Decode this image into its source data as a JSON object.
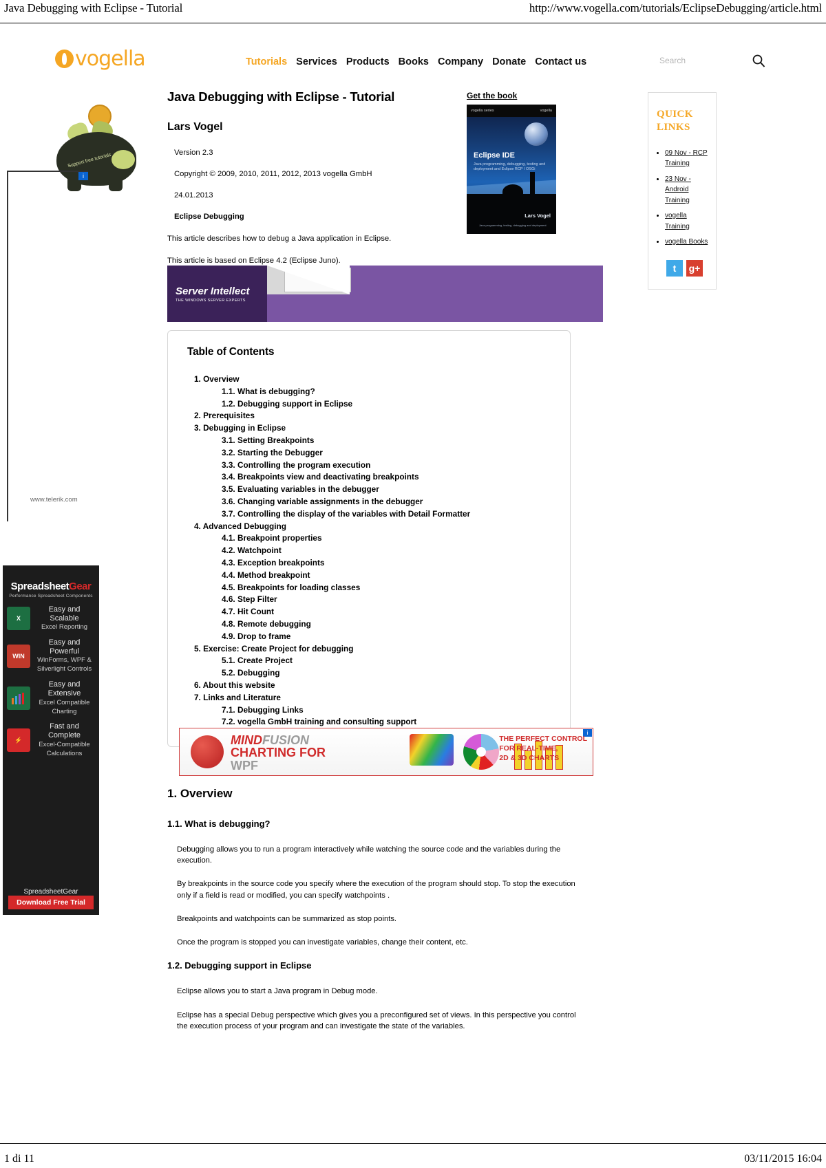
{
  "print": {
    "header_title": "Java Debugging with Eclipse - Tutorial",
    "header_url": "http://www.vogella.com/tutorials/EclipseDebugging/article.html",
    "footer_page": "1 di 11",
    "footer_timestamp": "03/11/2015 16:04"
  },
  "brand": {
    "logo_text": "vogella"
  },
  "nav": {
    "items": [
      {
        "label": "Tutorials",
        "active": true
      },
      {
        "label": "Services",
        "active": false
      },
      {
        "label": "Products",
        "active": false
      },
      {
        "label": "Books",
        "active": false
      },
      {
        "label": "Company",
        "active": false
      },
      {
        "label": "Donate",
        "active": false
      },
      {
        "label": "Contact us",
        "active": false
      }
    ],
    "search_placeholder": "Search"
  },
  "article": {
    "title": "Java Debugging with Eclipse - Tutorial",
    "author": "Lars Vogel",
    "version": "Version 2.3",
    "copyright": "Copyright © 2009, 2010, 2011, 2012, 2013 vogella GmbH",
    "date": "24.01.2013",
    "subject": "Eclipse Debugging",
    "intro1": "This article describes how to debug a Java application in Eclipse.",
    "intro2": "This article is based on Eclipse 4.2 (Eclipse Juno)."
  },
  "book_promo": {
    "label": "Get the book",
    "cover_brand_left": "vogella series",
    "cover_brand_right": "vogella",
    "cover_title": "Eclipse IDE",
    "cover_subtitle": "Java programming, debugging, testing and deployment and Eclipse RCP / OSGi",
    "cover_author": "Lars Vogel",
    "cover_footnote": "Java programming, testing, debugging and deployment"
  },
  "ads": {
    "server_intellect": {
      "name": "Server Intellect",
      "tagline": "THE WINDOWS SERVER EXPERTS"
    },
    "telerik": {
      "site": "www.telerik.com",
      "adchoice": "i"
    },
    "spreadsheetgear": {
      "logo_main": "Spreadsheet",
      "logo_accent": "Gear",
      "tagline": "Performance Spreadsheet Components",
      "features": [
        {
          "icon": "excel-icon",
          "icon_label": "X",
          "line1": "Easy and Scalable",
          "line2": "Excel Reporting"
        },
        {
          "icon": "winforms-icon",
          "icon_label": "WIN",
          "line1": "Easy and Powerful",
          "line2": "WinForms, WPF & Silverlight Controls"
        },
        {
          "icon": "chart-icon",
          "icon_label": "",
          "line1": "Easy and Extensive",
          "line2": "Excel Compatible Charting"
        },
        {
          "icon": "calc-icon",
          "icon_label": "",
          "line1": "Fast and Complete",
          "line2": "Excel-Compatible Calculations"
        }
      ],
      "footer_brand": "SpreadsheetGear",
      "cta": "Download Free Trial"
    },
    "mindfusion": {
      "line1_a": "MIND",
      "line1_b": "FUSION",
      "line2": "CHARTING FOR",
      "line3": "WPF",
      "right1": "THE PERFECT CONTROL",
      "right2": "FOR REAL-TIME,",
      "right3": "2D & 3D CHARTS",
      "adchoice": "i"
    }
  },
  "toc": {
    "heading": "Table of Contents",
    "items": [
      {
        "num": "1.",
        "label": "Overview",
        "level": 1
      },
      {
        "num": "1.1.",
        "label": "What is debugging?",
        "level": 2
      },
      {
        "num": "1.2.",
        "label": "Debugging support in Eclipse",
        "level": 2
      },
      {
        "num": "2.",
        "label": "Prerequisites",
        "level": 1
      },
      {
        "num": "3.",
        "label": "Debugging in Eclipse",
        "level": 1
      },
      {
        "num": "3.1.",
        "label": "Setting Breakpoints",
        "level": 2
      },
      {
        "num": "3.2.",
        "label": "Starting the Debugger",
        "level": 2
      },
      {
        "num": "3.3.",
        "label": "Controlling the program execution",
        "level": 2
      },
      {
        "num": "3.4.",
        "label": "Breakpoints view and deactivating breakpoints",
        "level": 2
      },
      {
        "num": "3.5.",
        "label": "Evaluating variables in the debugger",
        "level": 2
      },
      {
        "num": "3.6.",
        "label": "Changing variable assignments in the debugger",
        "level": 2
      },
      {
        "num": "3.7.",
        "label": "Controlling the display of the variables with Detail Formatter",
        "level": 2
      },
      {
        "num": "4.",
        "label": "Advanced Debugging",
        "level": 1
      },
      {
        "num": "4.1.",
        "label": "Breakpoint properties",
        "level": 2
      },
      {
        "num": "4.2.",
        "label": "Watchpoint",
        "level": 2
      },
      {
        "num": "4.3.",
        "label": "Exception breakpoints",
        "level": 2
      },
      {
        "num": "4.4.",
        "label": "Method breakpoint",
        "level": 2
      },
      {
        "num": "4.5.",
        "label": "Breakpoints for loading classes",
        "level": 2
      },
      {
        "num": "4.6.",
        "label": "Step Filter",
        "level": 2
      },
      {
        "num": "4.7.",
        "label": "Hit Count",
        "level": 2
      },
      {
        "num": "4.8.",
        "label": "Remote debugging",
        "level": 2
      },
      {
        "num": "4.9.",
        "label": "Drop to frame",
        "level": 2
      },
      {
        "num": "5.",
        "label": "Exercise: Create Project for debugging",
        "level": 1
      },
      {
        "num": "5.1.",
        "label": "Create Project",
        "level": 2
      },
      {
        "num": "5.2.",
        "label": "Debugging",
        "level": 2
      },
      {
        "num": "6.",
        "label": "About this website",
        "level": 1
      },
      {
        "num": "7.",
        "label": "Links and Literature",
        "level": 1
      },
      {
        "num": "7.1.",
        "label": "Debugging Links",
        "level": 2
      },
      {
        "num": "7.2.",
        "label": "vogella GmbH training and consulting support",
        "level": 2
      }
    ]
  },
  "content": {
    "section1_title": "1. Overview",
    "section11_title": "1.1. What is debugging?",
    "p1": "Debugging allows you to run a program interactively while watching the source code and the variables during the execution.",
    "p2": "By breakpoints in the source code you specify where the execution of the program should stop. To stop the execution only if a field is read or modified, you can specify watchpoints .",
    "p3": "Breakpoints and watchpoints can be summarized as stop points.",
    "p4": "Once the program is stopped you can investigate variables, change their content, etc.",
    "section12_title": "1.2. Debugging support in Eclipse",
    "p5": "Eclipse allows you to start a Java program in Debug mode.",
    "p6": "Eclipse has a special Debug perspective which gives you a preconfigured set of views. In this perspective you control the execution process of your program and can investigate the state of the variables."
  },
  "sidebar": {
    "heading": "QUICK LINKS",
    "links": [
      "09 Nov - RCP Training",
      "23 Nov - Android Training",
      "vogella Training",
      "vogella Books"
    ],
    "social": [
      {
        "name": "twitter",
        "glyph": "t"
      },
      {
        "name": "google-plus",
        "glyph": "g+"
      }
    ]
  }
}
